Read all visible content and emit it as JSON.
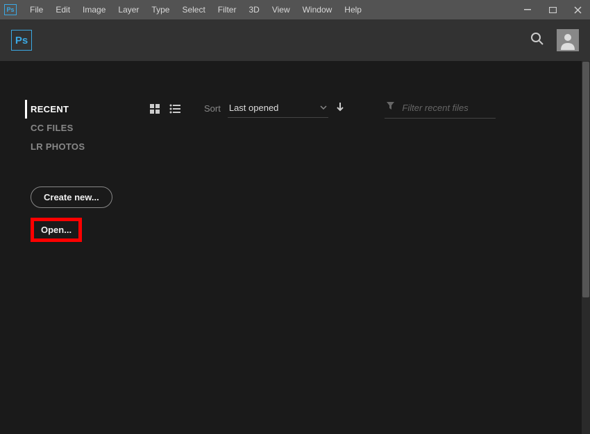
{
  "app_icon": "Ps",
  "menubar": {
    "items": [
      "File",
      "Edit",
      "Image",
      "Layer",
      "Type",
      "Select",
      "Filter",
      "3D",
      "View",
      "Window",
      "Help"
    ]
  },
  "sidebar": {
    "nav": [
      {
        "label": "RECENT",
        "active": true
      },
      {
        "label": "CC FILES",
        "active": false
      },
      {
        "label": "LR PHOTOS",
        "active": false
      }
    ],
    "create_label": "Create new...",
    "open_label": "Open..."
  },
  "toolbar": {
    "sort_label": "Sort",
    "sort_value": "Last opened",
    "filter_placeholder": "Filter recent files"
  }
}
